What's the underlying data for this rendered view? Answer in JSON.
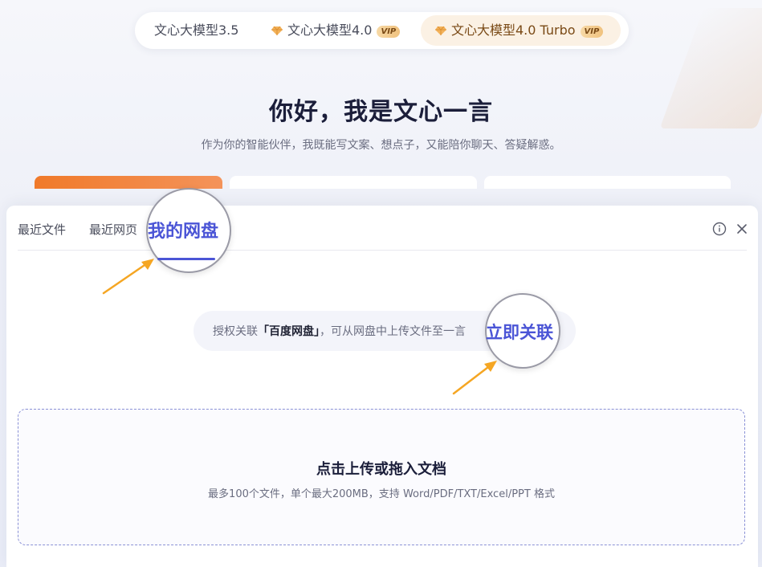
{
  "model_switcher": {
    "options": [
      {
        "label": "文心大模型3.5",
        "vip": false
      },
      {
        "label": "文心大模型4.0",
        "vip": true,
        "badge": "VIP"
      },
      {
        "label": "文心大模型4.0 Turbo",
        "vip": true,
        "badge": "VIP",
        "selected": true
      }
    ],
    "separator": "·"
  },
  "greeting": {
    "title": "你好，我是文心一言",
    "subtitle": "作为你的智能伙伴，我既能写文案、想点子，又能陪你聊天、答疑解惑。"
  },
  "file_panel": {
    "tabs": [
      {
        "label": "最近文件"
      },
      {
        "label": "最近网页"
      },
      {
        "label": "我的网盘",
        "active": true
      }
    ],
    "icons": {
      "info": "info-icon",
      "close": "close-icon"
    },
    "auth": {
      "prefix": "授权关联",
      "highlight": "「百度网盘」",
      "suffix": "，可从网盘中上传文件至一言",
      "link_label": "立即关联"
    },
    "upload": {
      "title": "点击上传或拖入文档",
      "hint": "最多100个文件，单个最大200MB，支持 Word/PDF/TXT/Excel/PPT 格式"
    }
  },
  "colors": {
    "accent": "#4b55d6",
    "highlight_orange": "#f07a2a",
    "arrow": "#f5a623",
    "vip_gold": "#f0c27e"
  }
}
